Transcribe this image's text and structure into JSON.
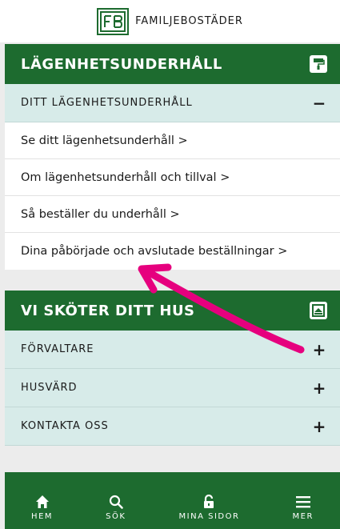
{
  "brand": {
    "name": "FAMILJEBOSTÄDER"
  },
  "section1": {
    "title": "LÄGENHETSUNDERHÅLL",
    "icon": "paint-roller-icon",
    "subheader": {
      "label": "DITT LÄGENHETSUNDERHÅLL",
      "sign": "−"
    },
    "links": [
      "Se ditt lägenhetsunderhåll >",
      "Om lägenhetsunderhåll och tillval >",
      "Så beställer du underhåll >",
      "Dina påbörjade och avslutade beställningar >"
    ]
  },
  "section2": {
    "title": "VI SKÖTER DITT HUS",
    "icon": "house-icon",
    "items": [
      {
        "label": "FÖRVALTARE",
        "sign": "+"
      },
      {
        "label": "HUSVÄRD",
        "sign": "+"
      },
      {
        "label": "KONTAKTA OSS",
        "sign": "+"
      }
    ]
  },
  "bottom_nav": [
    {
      "label": "HEM",
      "icon": "home-icon"
    },
    {
      "label": "SÖK",
      "icon": "search-icon"
    },
    {
      "label": "MINA SIDOR",
      "icon": "unlock-icon"
    },
    {
      "label": "MER",
      "icon": "menu-icon"
    }
  ],
  "colors": {
    "brand_green": "#1d6b2f",
    "accordion_bg": "#d7ebe9",
    "annotation": "#e6007e"
  }
}
